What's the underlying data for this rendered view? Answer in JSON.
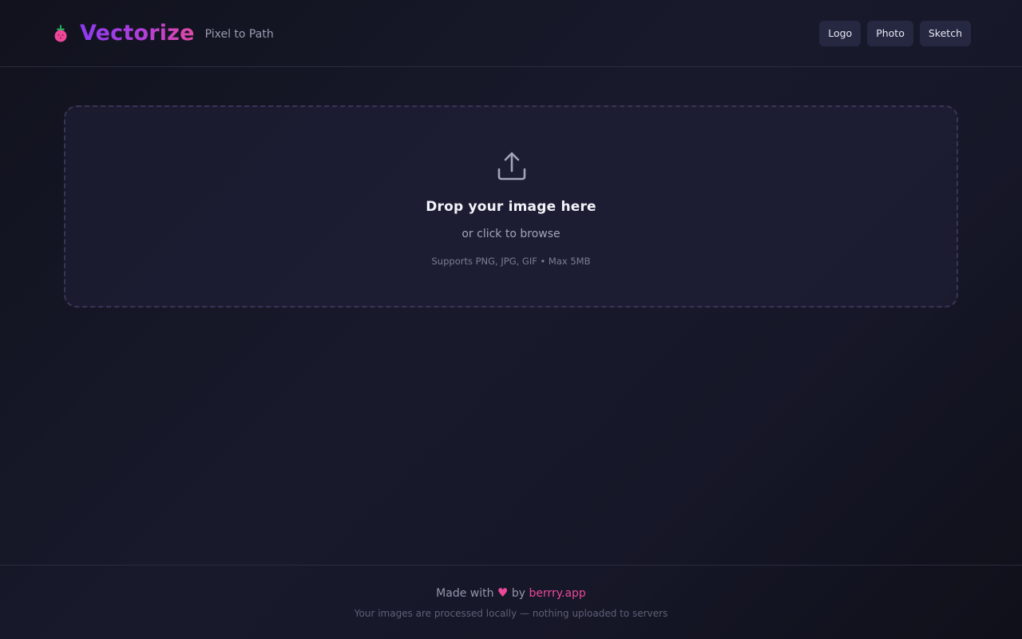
{
  "header": {
    "brand_name": "Vectorize",
    "tagline": "Pixel to Path",
    "logo_icon": "berry-icon",
    "presets": [
      {
        "label": "Logo"
      },
      {
        "label": "Photo"
      },
      {
        "label": "Sketch"
      }
    ]
  },
  "dropzone": {
    "icon": "upload-icon",
    "title": "Drop your image here",
    "subtitle": "or click to browse",
    "note": "Supports PNG, JPG, GIF • Max 5MB"
  },
  "footer": {
    "made_with": "Made with",
    "heart": "♥",
    "by": "by",
    "link_text": "berrry.app",
    "privacy": "Your images are processed locally — nothing uploaded to servers"
  },
  "colors": {
    "accent_purple": "#8b3cf0",
    "accent_pink": "#ec4899",
    "background": "#161728"
  }
}
